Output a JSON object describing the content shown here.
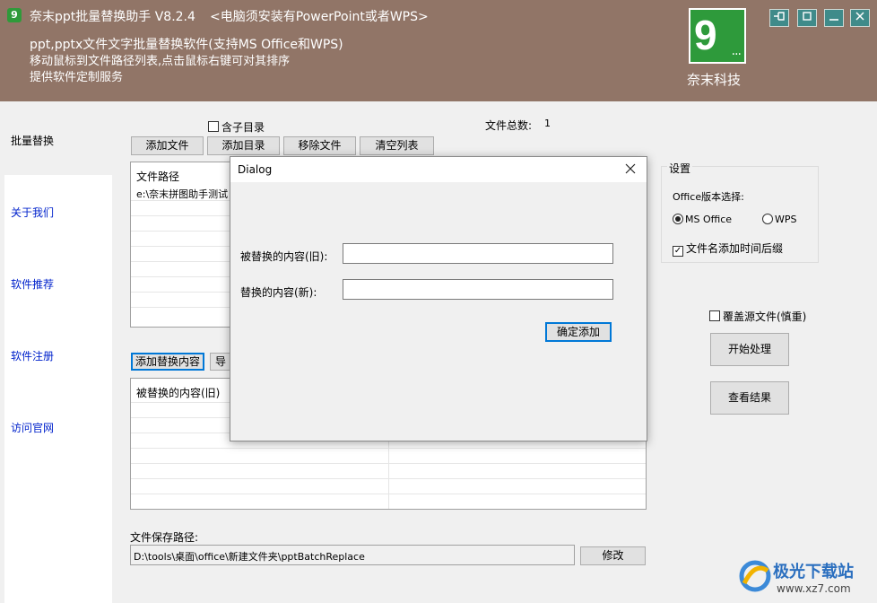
{
  "header": {
    "icon_glyph": "9",
    "title": "奈末ppt批量替换助手 V8.2.4",
    "notice": "<电脑须安装有PowerPoint或者WPS>",
    "lines": [
      "ppt,pptx文件文字批量替换软件(支持MS Office和WPS)",
      "移动鼠标到文件路径列表,点击鼠标右键可对其排序",
      "提供软件定制服务"
    ],
    "logo_digit": "9",
    "logo_dots": "...",
    "brand": "奈末科技",
    "background": "#917567"
  },
  "window_controls": {
    "pin": "pin-icon",
    "maximize": "maximize-icon",
    "minimize": "minimize-icon",
    "close": "close-icon"
  },
  "sidebar": {
    "items": [
      {
        "label": "批量替换",
        "active": true
      },
      {
        "label": "关于我们"
      },
      {
        "label": "软件推荐"
      },
      {
        "label": "软件注册"
      },
      {
        "label": "访问官网"
      }
    ]
  },
  "files": {
    "include_subdir_label": "含子目录",
    "total_label": "文件总数:",
    "total_value": "1",
    "buttons": [
      "添加文件",
      "添加目录",
      "移除文件",
      "清空列表"
    ],
    "list_header": "文件路径",
    "rows": [
      "e:\\奈末拼图助手测试"
    ]
  },
  "replace": {
    "add_button": "添加替换内容",
    "import_button": "导",
    "list_header": "被替换的内容(旧)"
  },
  "settings": {
    "title": "设置",
    "office_label": "Office版本选择:",
    "ms_office": "MS Office",
    "wps": "WPS",
    "selected": "MS Office",
    "timestamp_label": "文件名添加时间后缀",
    "timestamp_checked": true
  },
  "overwrite_label": "覆盖源文件(慎重)",
  "start_button": "开始处理",
  "results_button": "查看结果",
  "save_path": {
    "label": "文件保存路径:",
    "value": "D:\\tools\\桌面\\office\\新建文件夹\\pptBatchReplace",
    "modify_button": "修改"
  },
  "dialog": {
    "title": "Dialog",
    "old_label": "被替换的内容(旧):",
    "old_value": "",
    "new_label": "替换的内容(新):",
    "new_value": "",
    "confirm_button": "确定添加"
  },
  "watermark": {
    "brand": "极光下载站",
    "url": "www.xz7.com"
  }
}
